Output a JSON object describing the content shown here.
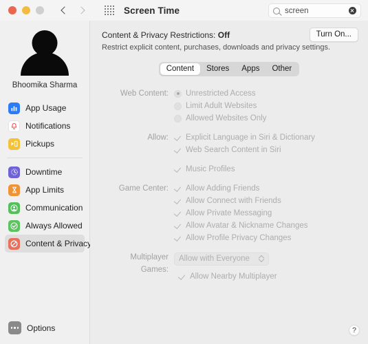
{
  "titlebar": {
    "title": "Screen Time",
    "grid_icon": "grid-apps-icon",
    "back_icon": "chevron-left-icon",
    "forward_icon": "chevron-right-icon",
    "lights": [
      "close-button",
      "minimize-button",
      "zoom-button"
    ],
    "search": {
      "value": "screen",
      "placeholder": "Search",
      "icon": "search-icon",
      "clear_icon": "clear-icon"
    }
  },
  "sidebar": {
    "user_name": "Bhoomika Sharma",
    "avatar_icon": "user-avatar-icon",
    "groups": [
      {
        "items": [
          {
            "label": "App Usage",
            "icon": "bar-chart-icon",
            "color": "#2b7cf6",
            "selected": false
          },
          {
            "label": "Notifications",
            "icon": "bell-icon",
            "color": "#ffffff",
            "selected": false
          },
          {
            "label": "Pickups",
            "icon": "pickup-icon",
            "color": "#f3c13a",
            "selected": false
          }
        ]
      },
      {
        "items": [
          {
            "label": "Downtime",
            "icon": "downtime-clock-icon",
            "color": "#6f62d4",
            "selected": false
          },
          {
            "label": "App Limits",
            "icon": "hourglass-icon",
            "color": "#ef9336",
            "selected": false
          },
          {
            "label": "Communication",
            "icon": "person-circle-icon",
            "color": "#53c05a",
            "selected": false
          },
          {
            "label": "Always Allowed",
            "icon": "check-circle-icon",
            "color": "#5bc45f",
            "selected": false
          },
          {
            "label": "Content & Privacy",
            "icon": "no-entry-icon",
            "color": "#e8705c",
            "selected": true
          }
        ]
      }
    ],
    "options": {
      "label": "Options",
      "icon": "ellipsis-icon"
    }
  },
  "main": {
    "header": {
      "title_prefix": "Content & Privacy Restrictions: ",
      "status": "Off",
      "subtitle": "Restrict explicit content, purchases, downloads and privacy settings.",
      "turn_on_label": "Turn On..."
    },
    "tabs": [
      {
        "label": "Content",
        "active": true
      },
      {
        "label": "Stores",
        "active": false
      },
      {
        "label": "Apps",
        "active": false
      },
      {
        "label": "Other",
        "active": false
      }
    ],
    "sections": {
      "web_content": {
        "label": "Web Content:",
        "options": [
          {
            "label": "Unrestricted Access",
            "selected": true
          },
          {
            "label": "Limit Adult Websites",
            "selected": false
          },
          {
            "label": "Allowed Websites Only",
            "selected": false
          }
        ]
      },
      "allow": {
        "label": "Allow:",
        "items": [
          {
            "label": "Explicit Language in Siri & Dictionary",
            "checked": true
          },
          {
            "label": "Web Search Content in Siri",
            "checked": true
          },
          {
            "label": "Music Profiles",
            "checked": true
          }
        ]
      },
      "game_center": {
        "label": "Game Center:",
        "items": [
          {
            "label": "Allow Adding Friends",
            "checked": true
          },
          {
            "label": "Allow Connect with Friends",
            "checked": true
          },
          {
            "label": "Allow Private Messaging",
            "checked": true
          },
          {
            "label": "Allow Avatar & Nickname Changes",
            "checked": true
          },
          {
            "label": "Allow Profile Privacy Changes",
            "checked": true
          }
        ]
      },
      "multiplayer": {
        "label": "Multiplayer Games:",
        "selected_value": "Allow with Everyone",
        "nearby": {
          "label": "Allow Nearby Multiplayer",
          "checked": true
        }
      }
    },
    "help_label": "?"
  }
}
